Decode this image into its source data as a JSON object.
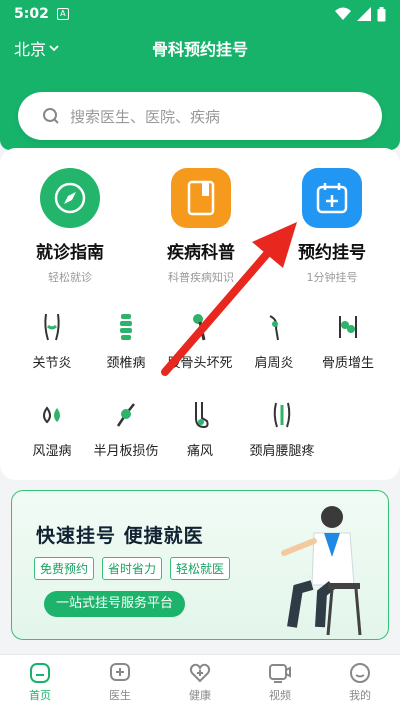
{
  "status_bar": {
    "time": "5:02"
  },
  "header": {
    "city": "北京",
    "title": "骨科预约挂号"
  },
  "search": {
    "placeholder": "搜索医生、医院、疾病"
  },
  "features": [
    {
      "name": "就诊指南",
      "sub": "轻松就诊",
      "icon": "compass-icon",
      "color": "#22b56b"
    },
    {
      "name": "疾病科普",
      "sub": "科普疾病知识",
      "icon": "book-icon",
      "color": "#f59a1c"
    },
    {
      "name": "预约挂号",
      "sub": "1分钟挂号",
      "icon": "calendar-plus-icon",
      "color": "#2196f3"
    }
  ],
  "diseases": [
    {
      "label": "关节炎",
      "icon": "knee-joint-icon"
    },
    {
      "label": "颈椎病",
      "icon": "spine-icon"
    },
    {
      "label": "股骨头坏死",
      "icon": "femur-icon"
    },
    {
      "label": "肩周炎",
      "icon": "shoulder-icon"
    },
    {
      "label": "骨质增生",
      "icon": "bone-spur-icon"
    },
    {
      "label": "风湿病",
      "icon": "droplets-icon"
    },
    {
      "label": "半月板损伤",
      "icon": "meniscus-icon"
    },
    {
      "label": "痛风",
      "icon": "foot-icon"
    },
    {
      "label": "颈肩腰腿疼",
      "icon": "back-icon"
    }
  ],
  "banner": {
    "title": "快速挂号  便捷就医",
    "tags": [
      "免费预约",
      "省时省力",
      "轻松就医"
    ],
    "cta": "一站式挂号服务平台"
  },
  "tabs": [
    {
      "label": "首页",
      "icon": "home-icon",
      "active": true
    },
    {
      "label": "医生",
      "icon": "doctor-icon",
      "active": false
    },
    {
      "label": "健康",
      "icon": "heart-plus-icon",
      "active": false
    },
    {
      "label": "视频",
      "icon": "video-icon",
      "active": false
    },
    {
      "label": "我的",
      "icon": "profile-icon",
      "active": false
    }
  ],
  "colors": {
    "brand": "#17b36a",
    "annotation_arrow": "#e8271f"
  }
}
